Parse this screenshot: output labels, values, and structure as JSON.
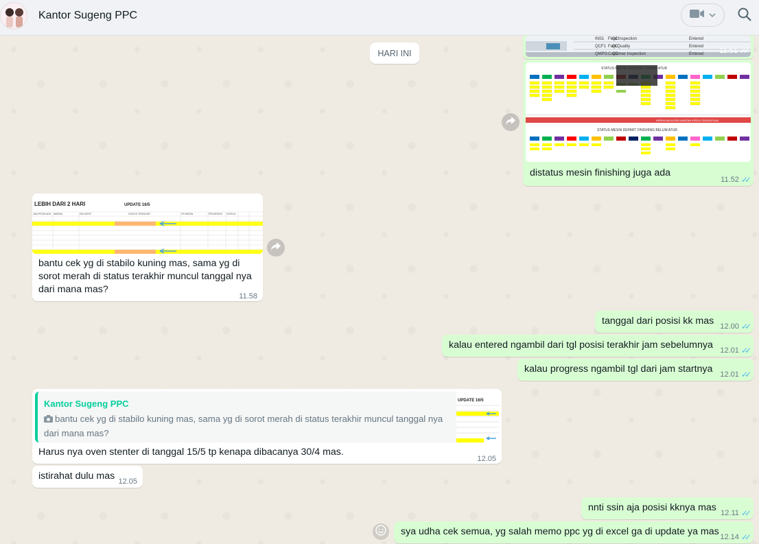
{
  "header": {
    "title": "Kantor Sugeng PPC"
  },
  "date_chip": "HARI INI",
  "messages": {
    "m1_time": "11.51",
    "m2_text": "distatus mesin finishing juga ada",
    "m2_time": "11.52",
    "m3_img_title": "LEBIH DARI 2 HARI",
    "m3_img_update": "UPDATE 16/5",
    "m3_text": "bantu cek yg di stabilo kuning mas, sama yg di sorot merah di status terakhir muncul tanggal nya dari mana mas?",
    "m3_time": "11.58",
    "m4_text": "tanggal dari posisi kk mas",
    "m4_time": "12.00",
    "m5_text": "kalau entered ngambil dari tgl posisi terakhir jam sebelumnya",
    "m5_time": "12.01",
    "m6_text": "kalau progress ngambil tgl dari jam startnya",
    "m6_time": "12.01",
    "m7_quote_name": "Kantor Sugeng PPC",
    "m7_quote_text": "bantu cek yg di stabilo kuning mas, sama yg di sorot merah di status terakhir muncul tanggal nya dari mana mas?",
    "m7_quote_thumb_title": "UPDATE 16/5",
    "m7_text": "Harus nya oven stenter di tanggal 15/5 tp kenapa dibacanya 30/4 mas.",
    "m7_time": "12.05",
    "m8_text": "istirahat dulu mas",
    "m8_time": "12.05",
    "m9_text": "nnti ssin aja posisi kknya mas",
    "m9_time": "12.11",
    "m10_text": "sya udha cek semua, yg salah memo ppc yg di excel ga di update ya mas",
    "m10_time": "12.14"
  },
  "screenshot_rows": {
    "top_codes": [
      "INS1",
      "QCF1",
      "QMPG"
    ],
    "top_qc": [
      "QC",
      "QC",
      "QC"
    ],
    "top_desc": [
      "Final Inspection",
      "Fast Quality",
      "Customer Inspection"
    ],
    "top_status": [
      "Entered",
      "Entered",
      "Entered"
    ],
    "status_titles": [
      "STATUS MESIN DEPART FINISHING BELUM ATUR"
    ]
  },
  "icons": {
    "video": "video-camera-icon",
    "search": "search-icon",
    "forward": "forward-icon",
    "emoji": "emoji-icon",
    "camera": "camera-icon"
  }
}
